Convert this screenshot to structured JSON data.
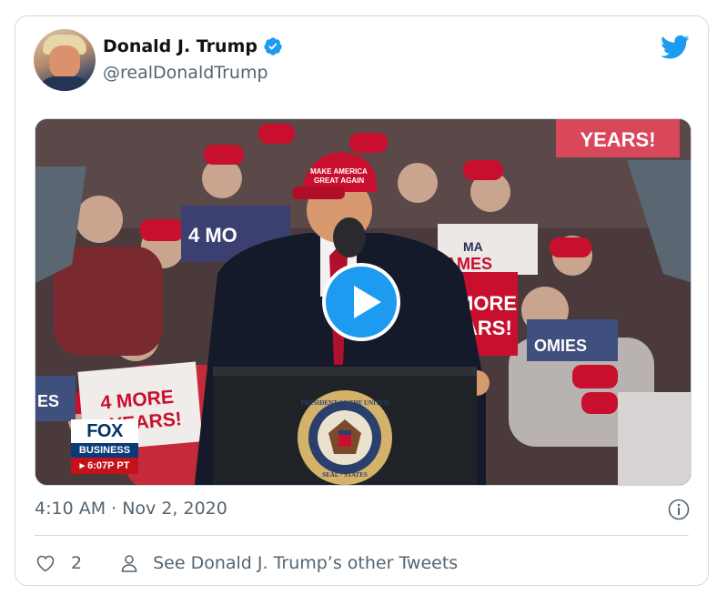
{
  "tweet": {
    "author_name": "Donald J. Trump",
    "author_handle": "@realDonaldTrump",
    "timestamp": "4:10 AM · Nov 2, 2020",
    "like_count": "2",
    "other_tweets_label": "See Donald J. Trump’s other Tweets"
  },
  "media": {
    "network_logo": "FOX",
    "network_sub": "BUSINESS",
    "network_time": "▸ 6:07P PT",
    "hat_text_line1": "MAKE AMERICA",
    "hat_text_line2": "GREAT AGAIN",
    "sign_left": "4 MORE",
    "sign_left_2": "YEARS!",
    "sign_top_right": "YEARS!",
    "sign_mid_left": "4 MO",
    "sign_mid_right_1": "MORE",
    "sign_mid_right_2": "ARS!",
    "sign_ma": "MA",
    "sign_ames": "AMES",
    "sign_omies": "OMIES",
    "sign_es": "ES",
    "seal_top": "PRESIDENT OF THE UNITED",
    "seal_bottom": "SEAL · STATES"
  },
  "icons": {
    "verified": "verified-badge-icon",
    "bird": "twitter-bird-icon",
    "info": "info-icon",
    "heart": "heart-icon",
    "person": "person-icon",
    "play": "play-icon"
  },
  "colors": {
    "accent": "#1d9bf0",
    "text_primary": "#0f1419",
    "text_secondary": "#536471",
    "border": "#cfd9de",
    "hat_red": "#c8102e"
  }
}
